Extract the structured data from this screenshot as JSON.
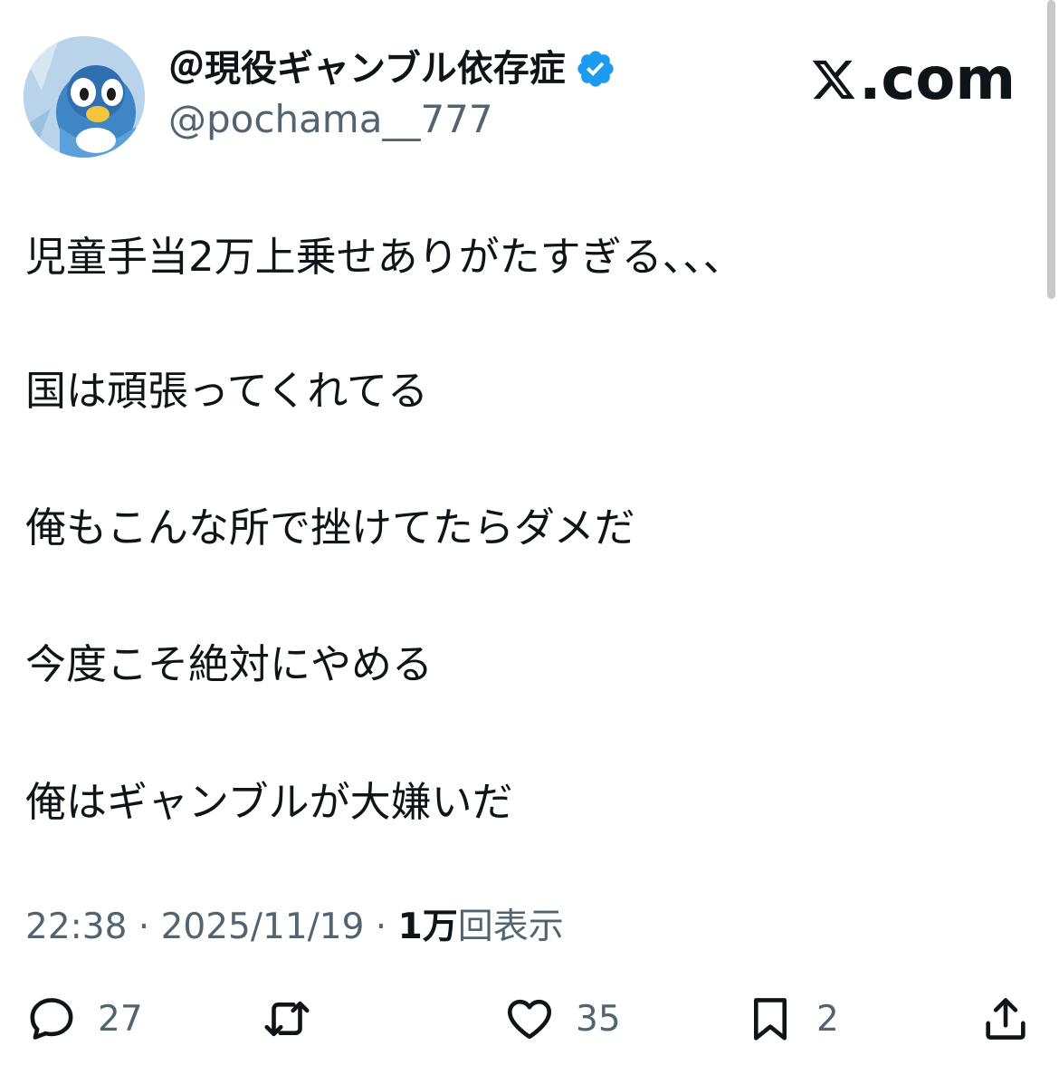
{
  "author": {
    "display_name": "＠現役ギャンブル依存症",
    "handle": "@pochama__777",
    "verified": true,
    "avatar_icon": "piplup-avatar-icon"
  },
  "brand": {
    "text": ".com",
    "logo_icon": "x-logo-icon"
  },
  "tweet": {
    "lines": [
      "児童手当2万上乗せありがたすぎる、、、",
      "国は頑張ってくれてる",
      "俺もこんな所で挫けてたらダメだ",
      "今度こそ絶対にやめる",
      "俺はギャンブルが大嫌いだ"
    ]
  },
  "meta": {
    "time": "22:38",
    "separator": " · ",
    "date": "2025/11/19",
    "views_count": "1万",
    "views_label": "回表示"
  },
  "actions": {
    "reply_count": "27",
    "retweet_count": "",
    "like_count": "35",
    "bookmark_count": "2"
  },
  "colors": {
    "text_primary": "#0f1419",
    "text_secondary": "#536471",
    "verified_blue": "#1d9bf0"
  }
}
